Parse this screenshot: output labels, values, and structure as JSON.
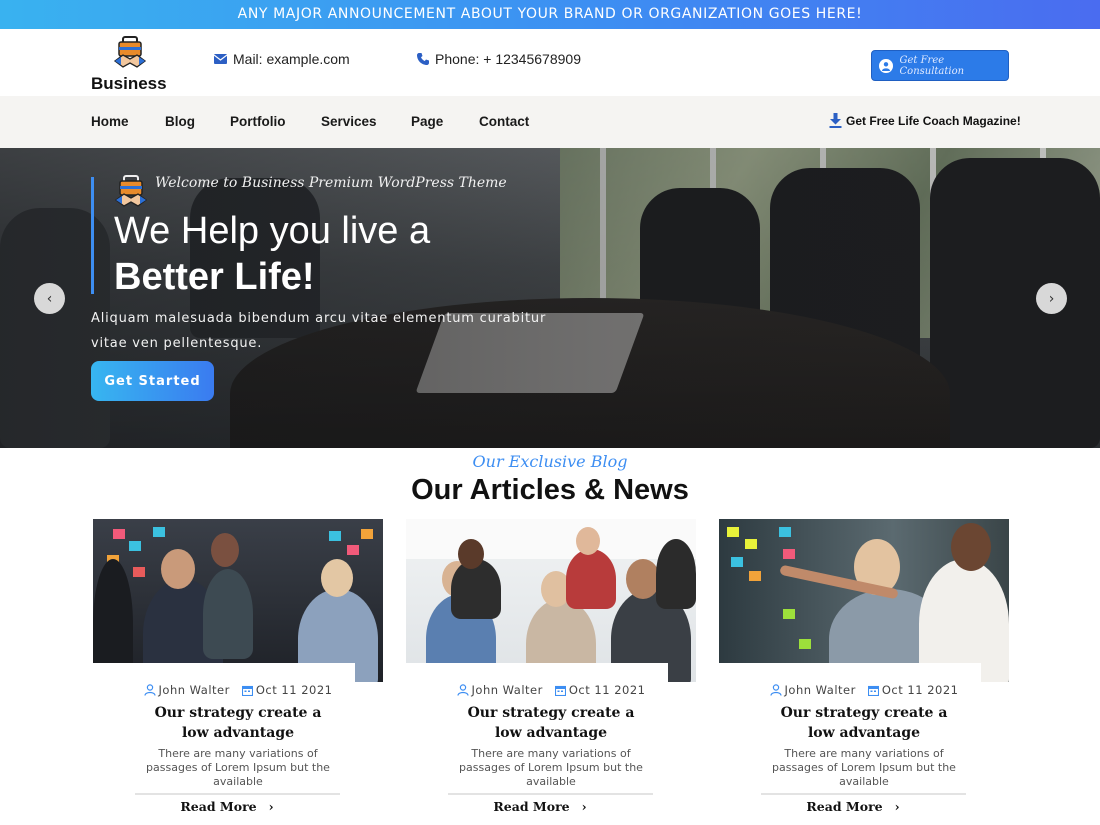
{
  "announcement": "ANY MAJOR ANNOUNCEMENT ABOUT YOUR BRAND OR ORGANIZATION GOES HERE!",
  "brand": {
    "name": "Business",
    "logo_icon": "handshake-briefcase-icon"
  },
  "header": {
    "mail": "Mail: example.com",
    "phone": "Phone: + 12345678909",
    "cta_label": "Get Free Consultation"
  },
  "nav": {
    "items": [
      "Home",
      "Blog",
      "Portfolio",
      "Services",
      "Page",
      "Contact"
    ],
    "cta": "Get Free Life Coach Magazine!"
  },
  "hero": {
    "welcome": "Welcome to Business Premium WordPress Theme",
    "title_line1": "We Help you live a",
    "title_line2": "Better Life!",
    "description": "Aliquam malesuada bibendum arcu vitae elementum curabitur vitae ven pellentesque.",
    "button": "Get Started",
    "prev": "‹",
    "next": "›"
  },
  "blog": {
    "subheading": "Our Exclusive Blog",
    "heading": "Our Articles & News",
    "cards": [
      {
        "author": "John Walter",
        "date": "Oct 11 2021",
        "title": "Our strategy create a low advantage",
        "text": "There are many variations of passages of Lorem Ipsum but the available",
        "read_more": "Read More"
      },
      {
        "author": "John Walter",
        "date": "Oct 11 2021",
        "title": "Our strategy create a low advantage",
        "text": "There are many variations of passages of Lorem Ipsum but the available",
        "read_more": "Read More"
      },
      {
        "author": "John Walter",
        "date": "Oct 11 2021",
        "title": "Our strategy create a low advantage",
        "text": "There are many variations of passages of Lorem Ipsum but the available",
        "read_more": "Read More"
      }
    ]
  },
  "colors": {
    "accent": "#3d8ef2",
    "nav_bg": "#f5f4f2",
    "button_gradient_start": "#37b6f0",
    "button_gradient_end": "#3a7bf0"
  }
}
